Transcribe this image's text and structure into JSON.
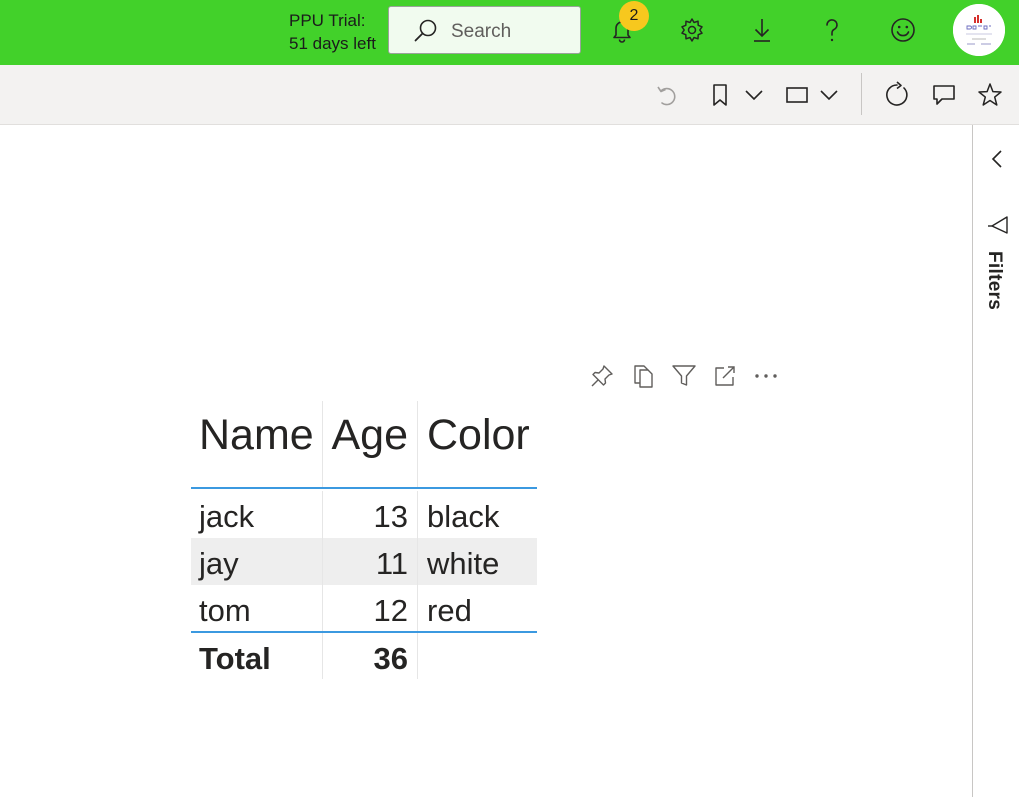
{
  "topbar": {
    "trial_line1": "PPU Trial:",
    "trial_line2": "51 days left",
    "search_placeholder": "Search",
    "notification_count": "2",
    "icons": [
      "bell-icon",
      "gear-icon",
      "download-icon",
      "help-icon",
      "smiley-icon"
    ],
    "avatar": "powerbi-avatar",
    "bg_color": "#42d12a"
  },
  "actionbar": {
    "icons": [
      "undo-icon",
      "bookmark-icon",
      "chevron-down-icon",
      "view-icon",
      "chevron-down-icon",
      "refresh-icon",
      "comment-icon",
      "star-icon"
    ]
  },
  "filters_pane": {
    "label": "Filters",
    "icons": [
      "chevron-left-icon",
      "filter-icon"
    ]
  },
  "visual_header": {
    "icons": [
      "pin-icon",
      "copy-visual-icon",
      "filter-icon",
      "focus-mode-icon",
      "more-options-icon"
    ]
  },
  "table": {
    "columns": [
      "Name",
      "Age",
      "Color"
    ],
    "rows": [
      {
        "name": "jack",
        "age": "13",
        "color": "black"
      },
      {
        "name": "jay",
        "age": "11",
        "color": "white"
      },
      {
        "name": "tom",
        "age": "12",
        "color": "red"
      }
    ],
    "total": {
      "label": "Total",
      "age": "36",
      "color": ""
    },
    "accent_color": "#3b99e0"
  }
}
